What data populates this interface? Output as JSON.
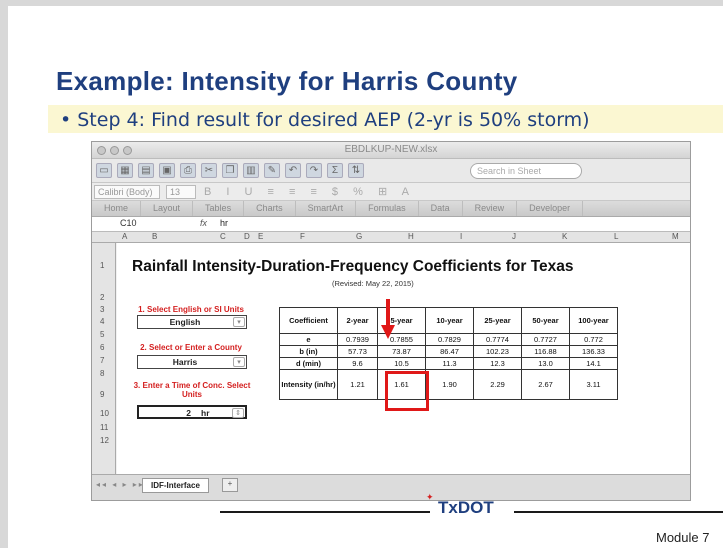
{
  "slide": {
    "title": "Example:  Intensity for Harris County",
    "bullet": "Step 4: Find result for desired AEP (2-yr is 50% storm)",
    "footer_logo": "TxDOT",
    "footer_module": "Module 7"
  },
  "window": {
    "title": "EBDLKUP-NEW.xlsx",
    "search_placeholder": "Search in Sheet"
  },
  "format_bar": {
    "font": "Calibri (Body)",
    "size": "13"
  },
  "ribbon_tabs": [
    "Home",
    "Layout",
    "Tables",
    "Charts",
    "SmartArt",
    "Formulas",
    "Data",
    "Review",
    "Developer"
  ],
  "formula_bar": {
    "cell": "C10",
    "fx": "fx",
    "value": "hr"
  },
  "columns": [
    "A",
    "B",
    "C",
    "D",
    "E",
    "F",
    "G",
    "H",
    "I",
    "J",
    "K",
    "L",
    "M"
  ],
  "rows": [
    "1",
    "2",
    "3",
    "4",
    "5",
    "6",
    "7",
    "8",
    "9",
    "10",
    "11",
    "12"
  ],
  "sheet": {
    "title": "Rainfall Intensity-Duration-Frequency Coefficients for Texas",
    "revised": "(Revised: May 22, 2015)",
    "step1_label": "1. Select English or SI Units",
    "step1_value": "English",
    "step2_label": "2. Select or Enter a County",
    "step2_value": "Harris",
    "step3_label": "3. Enter a Time of Conc. Select Units",
    "step3_value": "2",
    "step3_units": "hr"
  },
  "coef_table": {
    "headers": [
      "Coefficient",
      "2-year",
      "5-year",
      "10-year",
      "25-year",
      "50-year",
      "100-year"
    ],
    "rows": [
      [
        "e",
        "0.7939",
        "0.7855",
        "0.7829",
        "0.7774",
        "0.7727",
        "0.772"
      ],
      [
        "b (in)",
        "57.73",
        "73.87",
        "86.47",
        "102.23",
        "116.88",
        "136.33"
      ],
      [
        "d (min)",
        "9.6",
        "10.5",
        "11.3",
        "12.3",
        "13.0",
        "14.1"
      ],
      [
        "Intensity (in/hr)",
        "1.21",
        "1.61",
        "1.90",
        "2.29",
        "2.67",
        "3.11"
      ]
    ]
  },
  "sheet_tab": "IDF-Interface",
  "highlight_color": "#e01818"
}
